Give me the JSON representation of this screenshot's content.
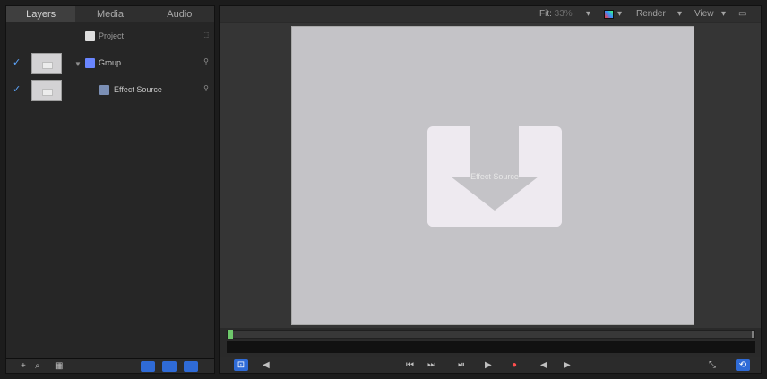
{
  "tabs": [
    {
      "label": "Layers"
    },
    {
      "label": "Media"
    },
    {
      "label": "Audio"
    }
  ],
  "layers": [
    {
      "name": "Project",
      "checked": false,
      "has_thumb": false
    },
    {
      "name": "Group",
      "checked": true,
      "has_thumb": true
    },
    {
      "name": "Effect Source",
      "checked": true,
      "has_thumb": true
    }
  ],
  "toolbar": {
    "fit_label": "Fit:",
    "fit_value": "33%",
    "render_label": "Render",
    "view_label": "View"
  },
  "canvas": {
    "drop_label": "Effect Source"
  },
  "icons": {
    "check": "✓",
    "disclosure": "▼",
    "add": "+",
    "search": "🔍",
    "play": "▶",
    "prev": "◀",
    "record": "●",
    "loop": "⟲"
  },
  "colors": {
    "accent": "#2f6bd7",
    "canvas_bg": "#c4c3c7",
    "drop_shape": "#eeeaf0"
  }
}
